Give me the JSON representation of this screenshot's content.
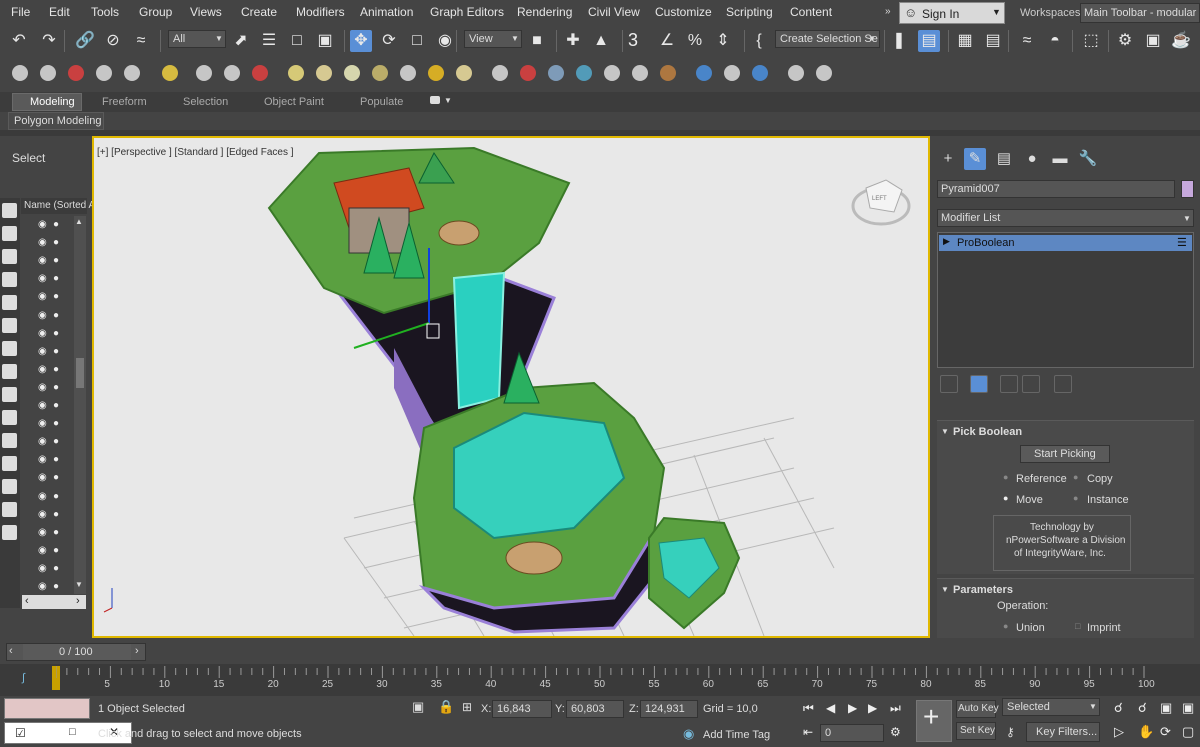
{
  "menu": [
    "File",
    "Edit",
    "Tools",
    "Group",
    "Views",
    "Create",
    "Modifiers",
    "Animation",
    "Graph Editors",
    "Rendering",
    "Civil View",
    "Customize",
    "Scripting",
    "Content"
  ],
  "signin": "Sign In",
  "workspaces_label": "Workspaces:",
  "workspace_value": "Main Toolbar - modular",
  "toolbar": {
    "filter_value": "All",
    "view_value": "View",
    "create_selection_set": "Create Selection Se",
    "snap_number": "3"
  },
  "ribbon": {
    "tabs": [
      "Modeling",
      "Freeform",
      "Selection",
      "Object Paint",
      "Populate"
    ],
    "active_tab": "Modeling",
    "sub_label": "Polygon Modeling"
  },
  "scene_explorer": {
    "select_label": "Select",
    "column_header": "Name (Sorted A"
  },
  "viewport": {
    "labels": "[+] [Perspective ] [Standard ] [Edged Faces ]",
    "viewcube_label": "LEFT"
  },
  "command_panel": {
    "object_name": "Pyramid007",
    "object_color": "#c6a8dc",
    "modifier_list": "Modifier List",
    "stack_item": "ProBoolean",
    "pick_boolean_title": "Pick Boolean",
    "start_picking": "Start Picking",
    "radio_reference": "Reference",
    "radio_copy": "Copy",
    "radio_move": "Move",
    "radio_instance": "Instance",
    "credit_line1": "Technology by",
    "credit_line2": "nPowerSoftware a Division",
    "credit_line3": "of IntegrityWare, Inc.",
    "parameters_title": "Parameters",
    "operation_label": "Operation:",
    "radio_union": "Union",
    "radio_imprint": "Imprint"
  },
  "timeline": {
    "frame_counter": "0 / 100",
    "ticks": [
      "5",
      "10",
      "15",
      "20",
      "25",
      "30",
      "35",
      "40",
      "45",
      "50",
      "55",
      "60",
      "65",
      "70",
      "75",
      "80",
      "85",
      "90",
      "95",
      "100"
    ]
  },
  "status": {
    "selection_text": "1 Object Selected",
    "prompt_text": "Click and drag to select and move objects",
    "x_label": "X:",
    "x_value": "16,843",
    "y_label": "Y:",
    "y_value": "60,803",
    "z_label": "Z:",
    "z_value": "124,931",
    "grid_text": "Grid = 10,0",
    "add_time_tag": "Add Time Tag",
    "auto_key": "Auto Key",
    "set_key": "Set Key",
    "selected_value": "Selected",
    "key_filters": "Key Filters...",
    "frame_value": "0"
  }
}
